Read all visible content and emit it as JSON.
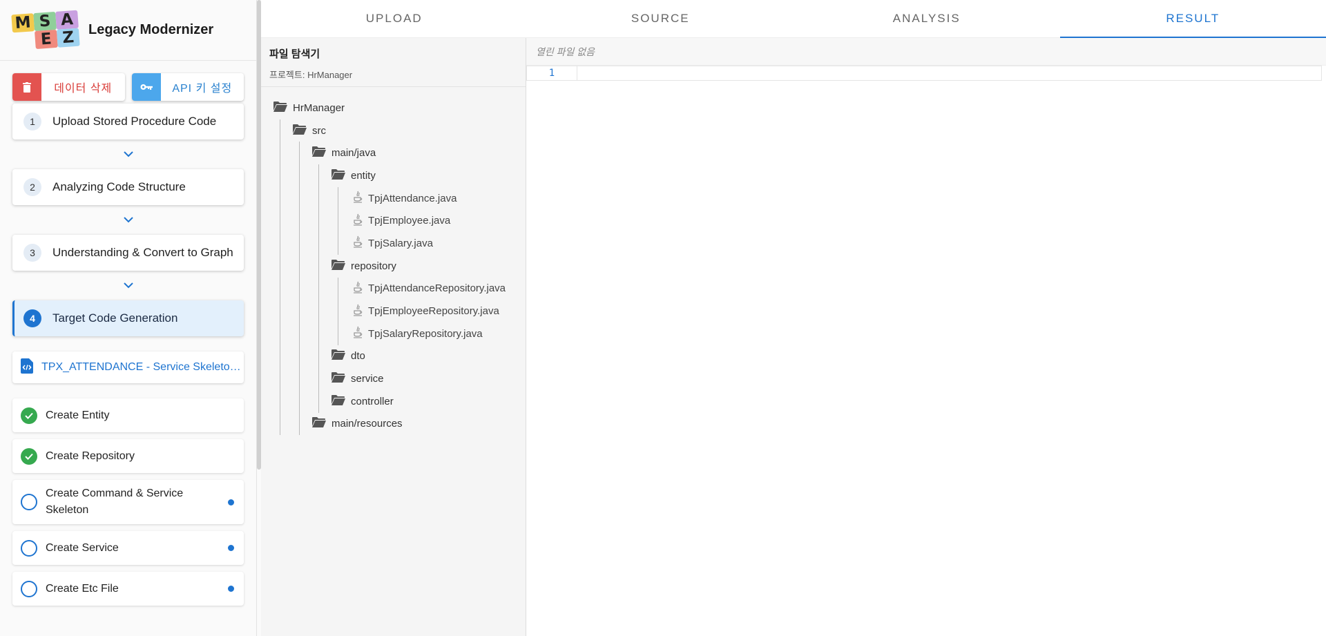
{
  "brand": {
    "logo_letters": [
      "M",
      "S",
      "A",
      "E",
      "Z"
    ],
    "name": "Legacy Modernizer"
  },
  "actions": {
    "delete_label": "데이터 삭제",
    "api_label": "API 키 설정"
  },
  "steps": [
    {
      "num": "1",
      "label": "Upload Stored Procedure Code"
    },
    {
      "num": "2",
      "label": "Analyzing Code Structure"
    },
    {
      "num": "3",
      "label": "Understanding & Convert to Graph"
    },
    {
      "num": "4",
      "label": "Target Code Generation",
      "active": true
    }
  ],
  "current_job": {
    "label": "TPX_ATTENDANCE - Service Skeleton..."
  },
  "tasks": [
    {
      "label": "Create Entity",
      "status": "done"
    },
    {
      "label": "Create Repository",
      "status": "done"
    },
    {
      "label": "Create Command & Service Skeleton",
      "status": "pending"
    },
    {
      "label": "Create Service",
      "status": "pending"
    },
    {
      "label": "Create Etc File",
      "status": "pending"
    }
  ],
  "tabs": [
    {
      "label": "UPLOAD"
    },
    {
      "label": "SOURCE"
    },
    {
      "label": "ANALYSIS"
    },
    {
      "label": "RESULT",
      "active": true
    }
  ],
  "explorer": {
    "title": "파일 탐색기",
    "project": "프로젝트: HrManager"
  },
  "tree": [
    {
      "label": "HrManager",
      "type": "folder",
      "depth": 0
    },
    {
      "label": "src",
      "type": "folder",
      "depth": 1
    },
    {
      "label": "main/java",
      "type": "folder",
      "depth": 2
    },
    {
      "label": "entity",
      "type": "folder",
      "depth": 3
    },
    {
      "label": "TpjAttendance.java",
      "type": "java",
      "depth": 4
    },
    {
      "label": "TpjEmployee.java",
      "type": "java",
      "depth": 4
    },
    {
      "label": "TpjSalary.java",
      "type": "java",
      "depth": 4
    },
    {
      "label": "repository",
      "type": "folder",
      "depth": 3
    },
    {
      "label": "TpjAttendanceRepository.java",
      "type": "java",
      "depth": 4
    },
    {
      "label": "TpjEmployeeRepository.java",
      "type": "java",
      "depth": 4
    },
    {
      "label": "TpjSalaryRepository.java",
      "type": "java",
      "depth": 4
    },
    {
      "label": "dto",
      "type": "folder",
      "depth": 3
    },
    {
      "label": "service",
      "type": "folder",
      "depth": 3
    },
    {
      "label": "controller",
      "type": "folder",
      "depth": 3
    },
    {
      "label": "main/resources",
      "type": "folder",
      "depth": 2
    }
  ],
  "editor": {
    "placeholder": "열린 파일 없음",
    "line_number": "1"
  },
  "colors": {
    "accent": "#1e74d0",
    "danger": "#e35350",
    "success": "#36a94f",
    "logo_tiles": [
      "#f2c94c",
      "#8fcf9a",
      "#c9a0e0",
      "#f08a7e",
      "#9fd3f0"
    ]
  }
}
